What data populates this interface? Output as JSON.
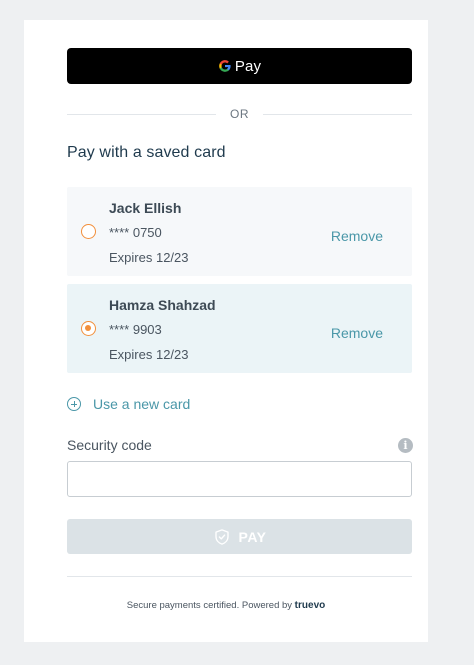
{
  "gpay": {
    "label": "Pay"
  },
  "divider": {
    "text": "OR"
  },
  "saved": {
    "title": "Pay with a saved card",
    "cards": [
      {
        "name": "Jack Ellish",
        "number": "**** 0750",
        "expires": "Expires 12/23",
        "selected": false,
        "remove_label": "Remove"
      },
      {
        "name": "Hamza Shahzad",
        "number": "**** 9903",
        "expires": "Expires 12/23",
        "selected": true,
        "remove_label": "Remove"
      }
    ]
  },
  "new_card": {
    "label": "Use a new card",
    "icon": "plus-circle-icon"
  },
  "security": {
    "label": "Security code",
    "value": "",
    "info_icon": "info-icon"
  },
  "pay_button": {
    "label": "PAY",
    "icon": "shield-check-icon",
    "enabled": false
  },
  "footer": {
    "text": "Secure payments certified. Powered by",
    "brand": "truevo"
  },
  "colors": {
    "accent": "#4a97a8",
    "radio": "#f28f3b",
    "title": "#1f3a4d",
    "selected_card_bg": "#ebf4f7",
    "card_bg": "#f6f8fa",
    "pay_disabled": "#dbe2e6"
  }
}
